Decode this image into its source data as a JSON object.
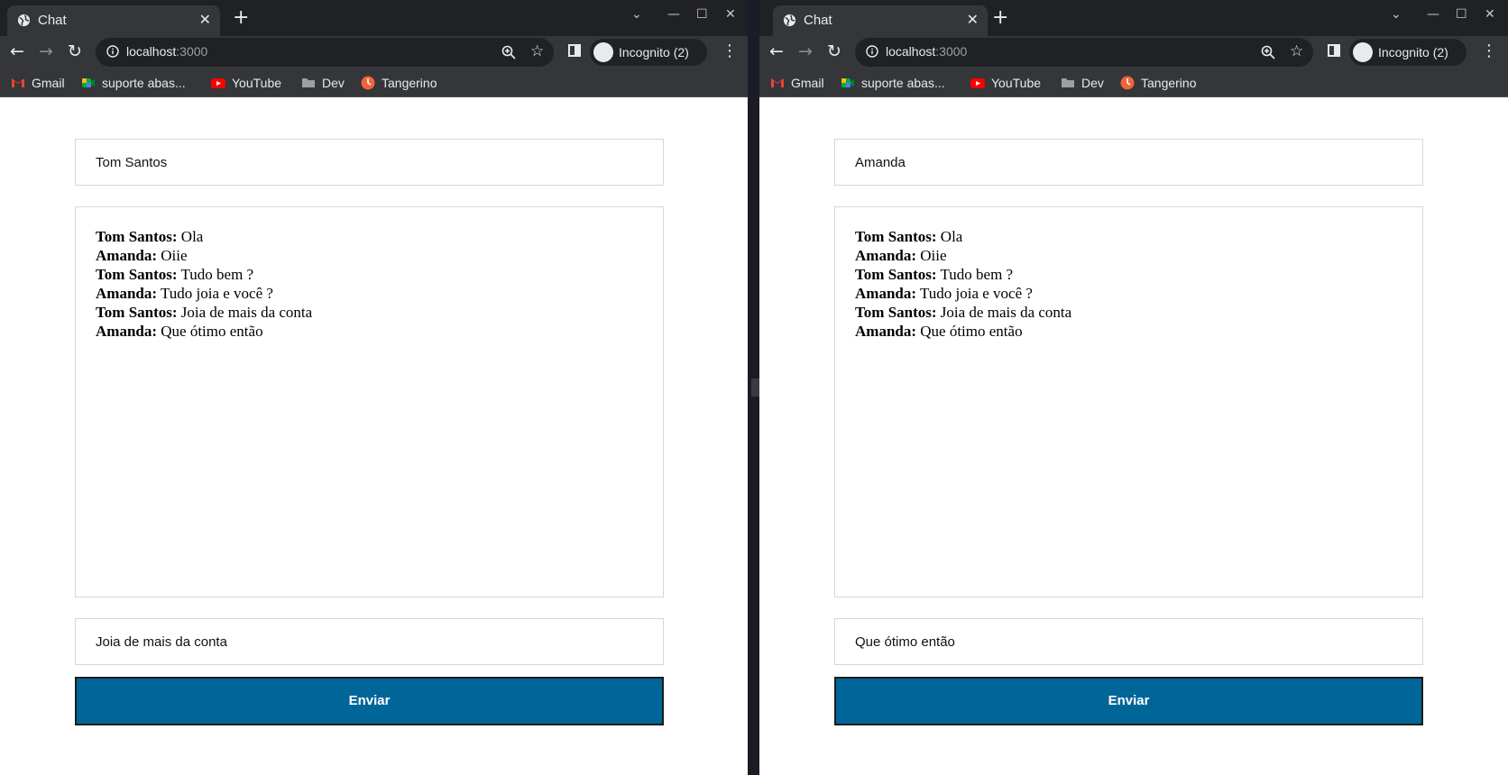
{
  "windows": [
    {
      "tab_title": "Chat",
      "url_host": "localhost",
      "url_port": ":3000",
      "incognito_label": "Incognito (2)",
      "bookmarks": [
        "Gmail",
        "suporte abas...",
        "YouTube",
        "Dev",
        "Tangerino"
      ],
      "username": "Tom Santos",
      "messages": [
        {
          "author": "Tom Santos:",
          "text": " Ola"
        },
        {
          "author": "Amanda:",
          "text": " Oiie"
        },
        {
          "author": "Tom Santos:",
          "text": " Tudo bem ?"
        },
        {
          "author": "Amanda:",
          "text": " Tudo joia e você ?"
        },
        {
          "author": "Tom Santos:",
          "text": " Joia de mais da conta"
        },
        {
          "author": "Amanda:",
          "text": " Que ótimo então"
        }
      ],
      "message_input": "Joia de mais da conta",
      "send_label": "Enviar"
    },
    {
      "tab_title": "Chat",
      "url_host": "localhost",
      "url_port": ":3000",
      "incognito_label": "Incognito (2)",
      "bookmarks": [
        "Gmail",
        "suporte abas...",
        "YouTube",
        "Dev",
        "Tangerino"
      ],
      "username": "Amanda",
      "messages": [
        {
          "author": "Tom Santos:",
          "text": " Ola"
        },
        {
          "author": "Amanda:",
          "text": " Oiie"
        },
        {
          "author": "Tom Santos:",
          "text": " Tudo bem ?"
        },
        {
          "author": "Amanda:",
          "text": " Tudo joia e você ?"
        },
        {
          "author": "Tom Santos:",
          "text": " Joia de mais da conta"
        },
        {
          "author": "Amanda:",
          "text": " Que ótimo então"
        }
      ],
      "message_input": "Que ótimo então",
      "send_label": "Enviar"
    }
  ],
  "colors": {
    "send_button": "#006699",
    "chrome_frame": "#202124",
    "chrome_toolbar": "#35363a"
  },
  "icons": [
    "globe-icon",
    "close-icon",
    "new-tab-icon",
    "back-icon",
    "forward-icon",
    "reload-icon",
    "info-icon",
    "zoom-icon",
    "star-icon",
    "side-panel-icon",
    "incognito-icon",
    "menu-icon",
    "gmail-icon",
    "meet-icon",
    "youtube-icon",
    "folder-icon",
    "clock-icon"
  ]
}
